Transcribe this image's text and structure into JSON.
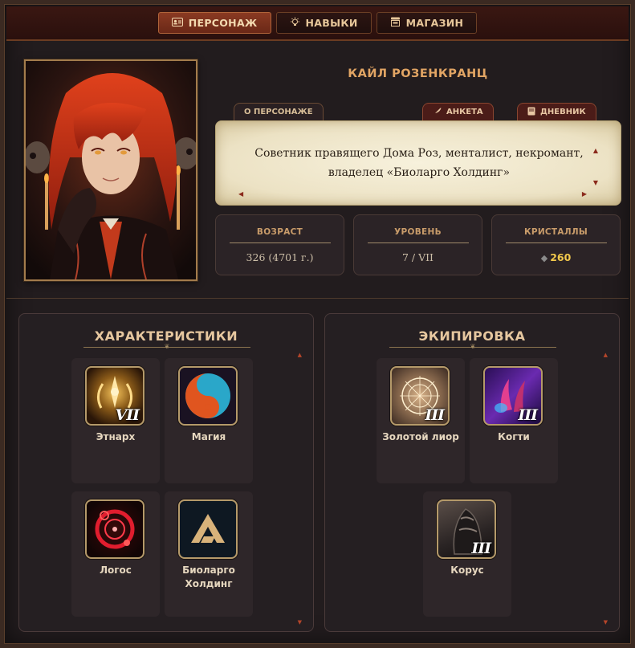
{
  "nav": {
    "tabs": [
      {
        "label": "ПЕРСОНАЖ",
        "icon": "id-card-icon",
        "active": true
      },
      {
        "label": "НАВЫКИ",
        "icon": "lightbulb-icon",
        "active": false
      },
      {
        "label": "МАГАЗИН",
        "icon": "shop-icon",
        "active": false
      }
    ]
  },
  "profile": {
    "name": "КАЙЛ РОЗЕНКРАНЦ",
    "about_tab": "О ПЕРСОНАЖЕ",
    "form_button": "АНКЕТА",
    "diary_button": "ДНЕВНИК",
    "description": "Советник правящего Дома Роз, менталист, некромант, владелец «Биоларго Холдинг»"
  },
  "stats": [
    {
      "label": "ВОЗРАСТ",
      "value": "326 (4701 г.)"
    },
    {
      "label": "УРОВЕНЬ",
      "value": "7 / VII"
    },
    {
      "label": "КРИСТАЛЛЫ",
      "value": "260"
    }
  ],
  "characteristics": {
    "title": "ХАРАКТЕРИСТИКИ",
    "items": [
      {
        "label": "Этнарх",
        "rank": "VII",
        "icon": "laurel-emblem-icon"
      },
      {
        "label": "Магия",
        "rank": "",
        "icon": "yin-yang-icon"
      },
      {
        "label": "Логос",
        "rank": "",
        "icon": "red-rune-circle-icon"
      },
      {
        "label": "Биоларго Холдинг",
        "rank": "",
        "icon": "gold-triangle-logo-icon"
      }
    ]
  },
  "equipment": {
    "title": "ЭКИПИРОВКА",
    "items": [
      {
        "label": "Золотой лиор",
        "rank": "III",
        "icon": "golden-sigil-icon"
      },
      {
        "label": "Когти",
        "rank": "III",
        "icon": "claws-icon"
      },
      {
        "label": "Корус",
        "rank": "III",
        "icon": "armor-icon"
      }
    ]
  },
  "colors": {
    "accent": "#e2a564",
    "active_tab": "#8a3a22",
    "crystal": "#f2c94c",
    "parchment": "#f3ecd2"
  }
}
